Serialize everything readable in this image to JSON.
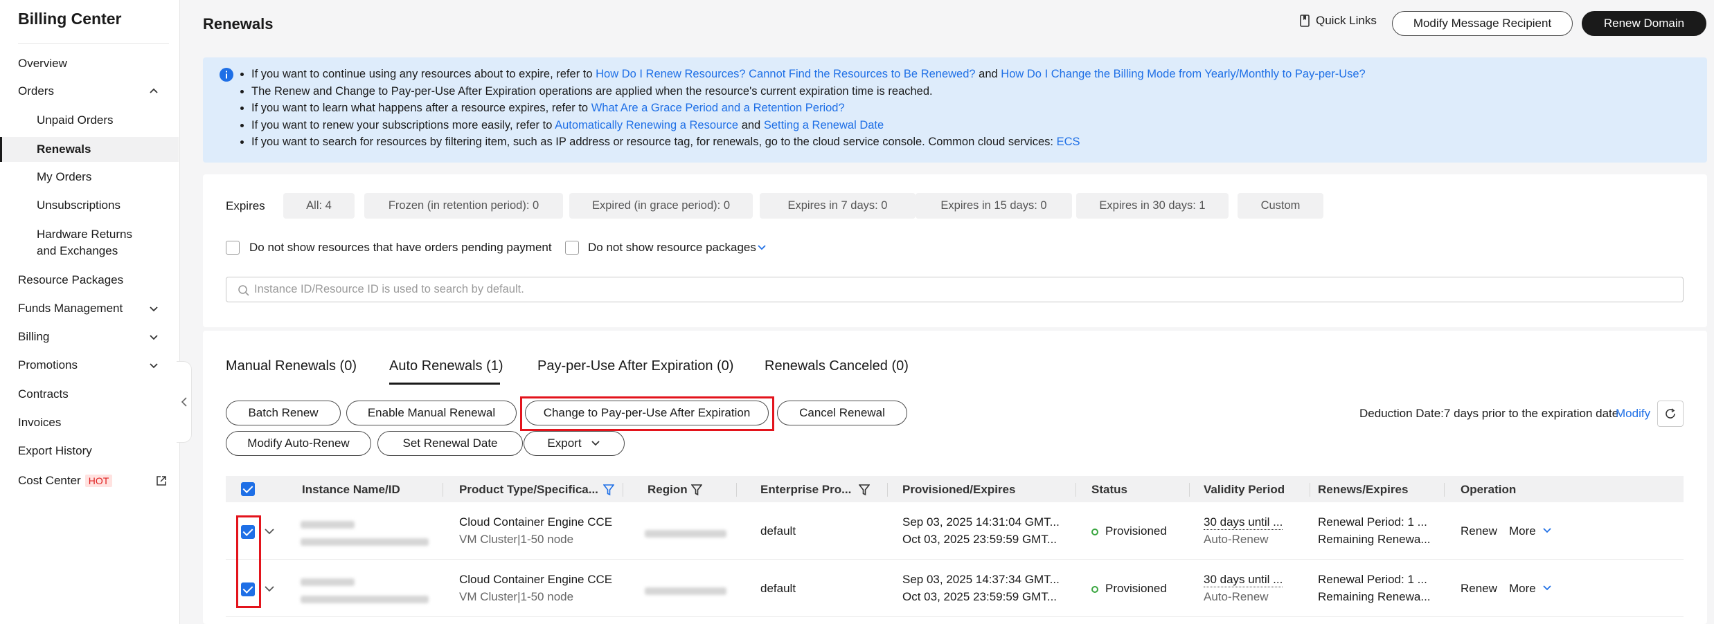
{
  "sidebar": {
    "title": "Billing Center",
    "items": {
      "overview": "Overview",
      "orders": "Orders",
      "unpaid": "Unpaid Orders",
      "renewals": "Renewals",
      "my_orders": "My Orders",
      "unsub": "Unsubscriptions",
      "hardware": "Hardware Returns",
      "hardware2": "and Exchanges",
      "packages": "Resource Packages",
      "funds": "Funds Management",
      "billing": "Billing",
      "promotions": "Promotions",
      "contracts": "Contracts",
      "invoices": "Invoices",
      "export": "Export History",
      "cost": "Cost Center",
      "hot": "HOT"
    }
  },
  "header": {
    "title": "Renewals",
    "quick_links": "Quick Links",
    "modify_recipient": "Modify Message Recipient",
    "renew_domain": "Renew Domain"
  },
  "notice": {
    "l1a": "If you want to continue using any resources about to expire, refer to ",
    "l1b": "How Do I Renew Resources? Cannot Find the Resources to Be Renewed?",
    "l1c": " and ",
    "l1d": "How Do I Change the Billing Mode from Yearly/Monthly to Pay-per-Use?",
    "l2": "The Renew and Change to Pay-per-Use After Expiration operations are applied when the resource's current expiration time is reached.",
    "l3a": "If you want to learn what happens after a resource expires, refer to ",
    "l3b": "What Are a Grace Period and a Retention Period?",
    "l4a": "If you want to renew your subscriptions more easily, refer to ",
    "l4b": "Automatically Renewing a Resource",
    "l4c": " and ",
    "l4d": "Setting a Renewal Date",
    "l5a": "If you want to search for resources by filtering item, such as IP address or resource tag, for renewals, go to the cloud service console. Common cloud services: ",
    "l5b": "ECS"
  },
  "filters": {
    "label": "Expires",
    "chips": [
      "All: 4",
      "Frozen (in retention period): 0",
      "Expired (in grace period): 0",
      "Expires in 7 days: 0",
      "Expires in 15 days: 0",
      "Expires in 30 days: 1",
      "Custom"
    ],
    "pending": "Do not show resources that have orders pending payment",
    "packages": "Do not show resource packages",
    "search_placeholder": "Instance ID/Resource ID is used to search by default."
  },
  "tabs": [
    "Manual Renewals (0)",
    "Auto Renewals (1)",
    "Pay-per-Use After Expiration (0)",
    "Renewals Canceled (0)"
  ],
  "actions": {
    "batch": "Batch Renew",
    "manual": "Enable Manual Renewal",
    "payg": "Change to Pay-per-Use After Expiration",
    "cancel": "Cancel Renewal",
    "modify": "Modify Auto-Renew",
    "set_date": "Set Renewal Date",
    "export": "Export",
    "deduction": "Deduction Date:7 days prior to the expiration date",
    "modify_link": "Modify"
  },
  "table": {
    "headers": [
      "Instance Name/ID",
      "Product Type/Specifica...",
      "Region",
      "Enterprise Pro...",
      "Provisioned/Expires",
      "Status",
      "Validity Period",
      "Renews/Expires",
      "Operation"
    ],
    "rows": [
      {
        "product": "Cloud Container Engine CCE",
        "spec": "VM Cluster|1-50 node",
        "project": "default",
        "provisioned": "Sep 03, 2025 14:31:04 GMT...",
        "expires": "Oct 03, 2025 23:59:59 GMT...",
        "status": "Provisioned",
        "validity": "30 days until ...",
        "validity2": "Auto-Renew",
        "renew1": "Renewal Period: 1 ...",
        "renew2": "Remaining Renewa...",
        "op_renew": "Renew",
        "op_more": "More"
      },
      {
        "product": "Cloud Container Engine CCE",
        "spec": "VM Cluster|1-50 node",
        "project": "default",
        "provisioned": "Sep 03, 2025 14:37:34 GMT...",
        "expires": "Oct 03, 2025 23:59:59 GMT...",
        "status": "Provisioned",
        "validity": "30 days until ...",
        "validity2": "Auto-Renew",
        "renew1": "Renewal Period: 1 ...",
        "renew2": "Remaining Renewa...",
        "op_renew": "Renew",
        "op_more": "More"
      }
    ]
  },
  "colors": {
    "accent": "#1e6fe6",
    "highlight": "#e3141c",
    "status_ok": "#3aa640"
  }
}
